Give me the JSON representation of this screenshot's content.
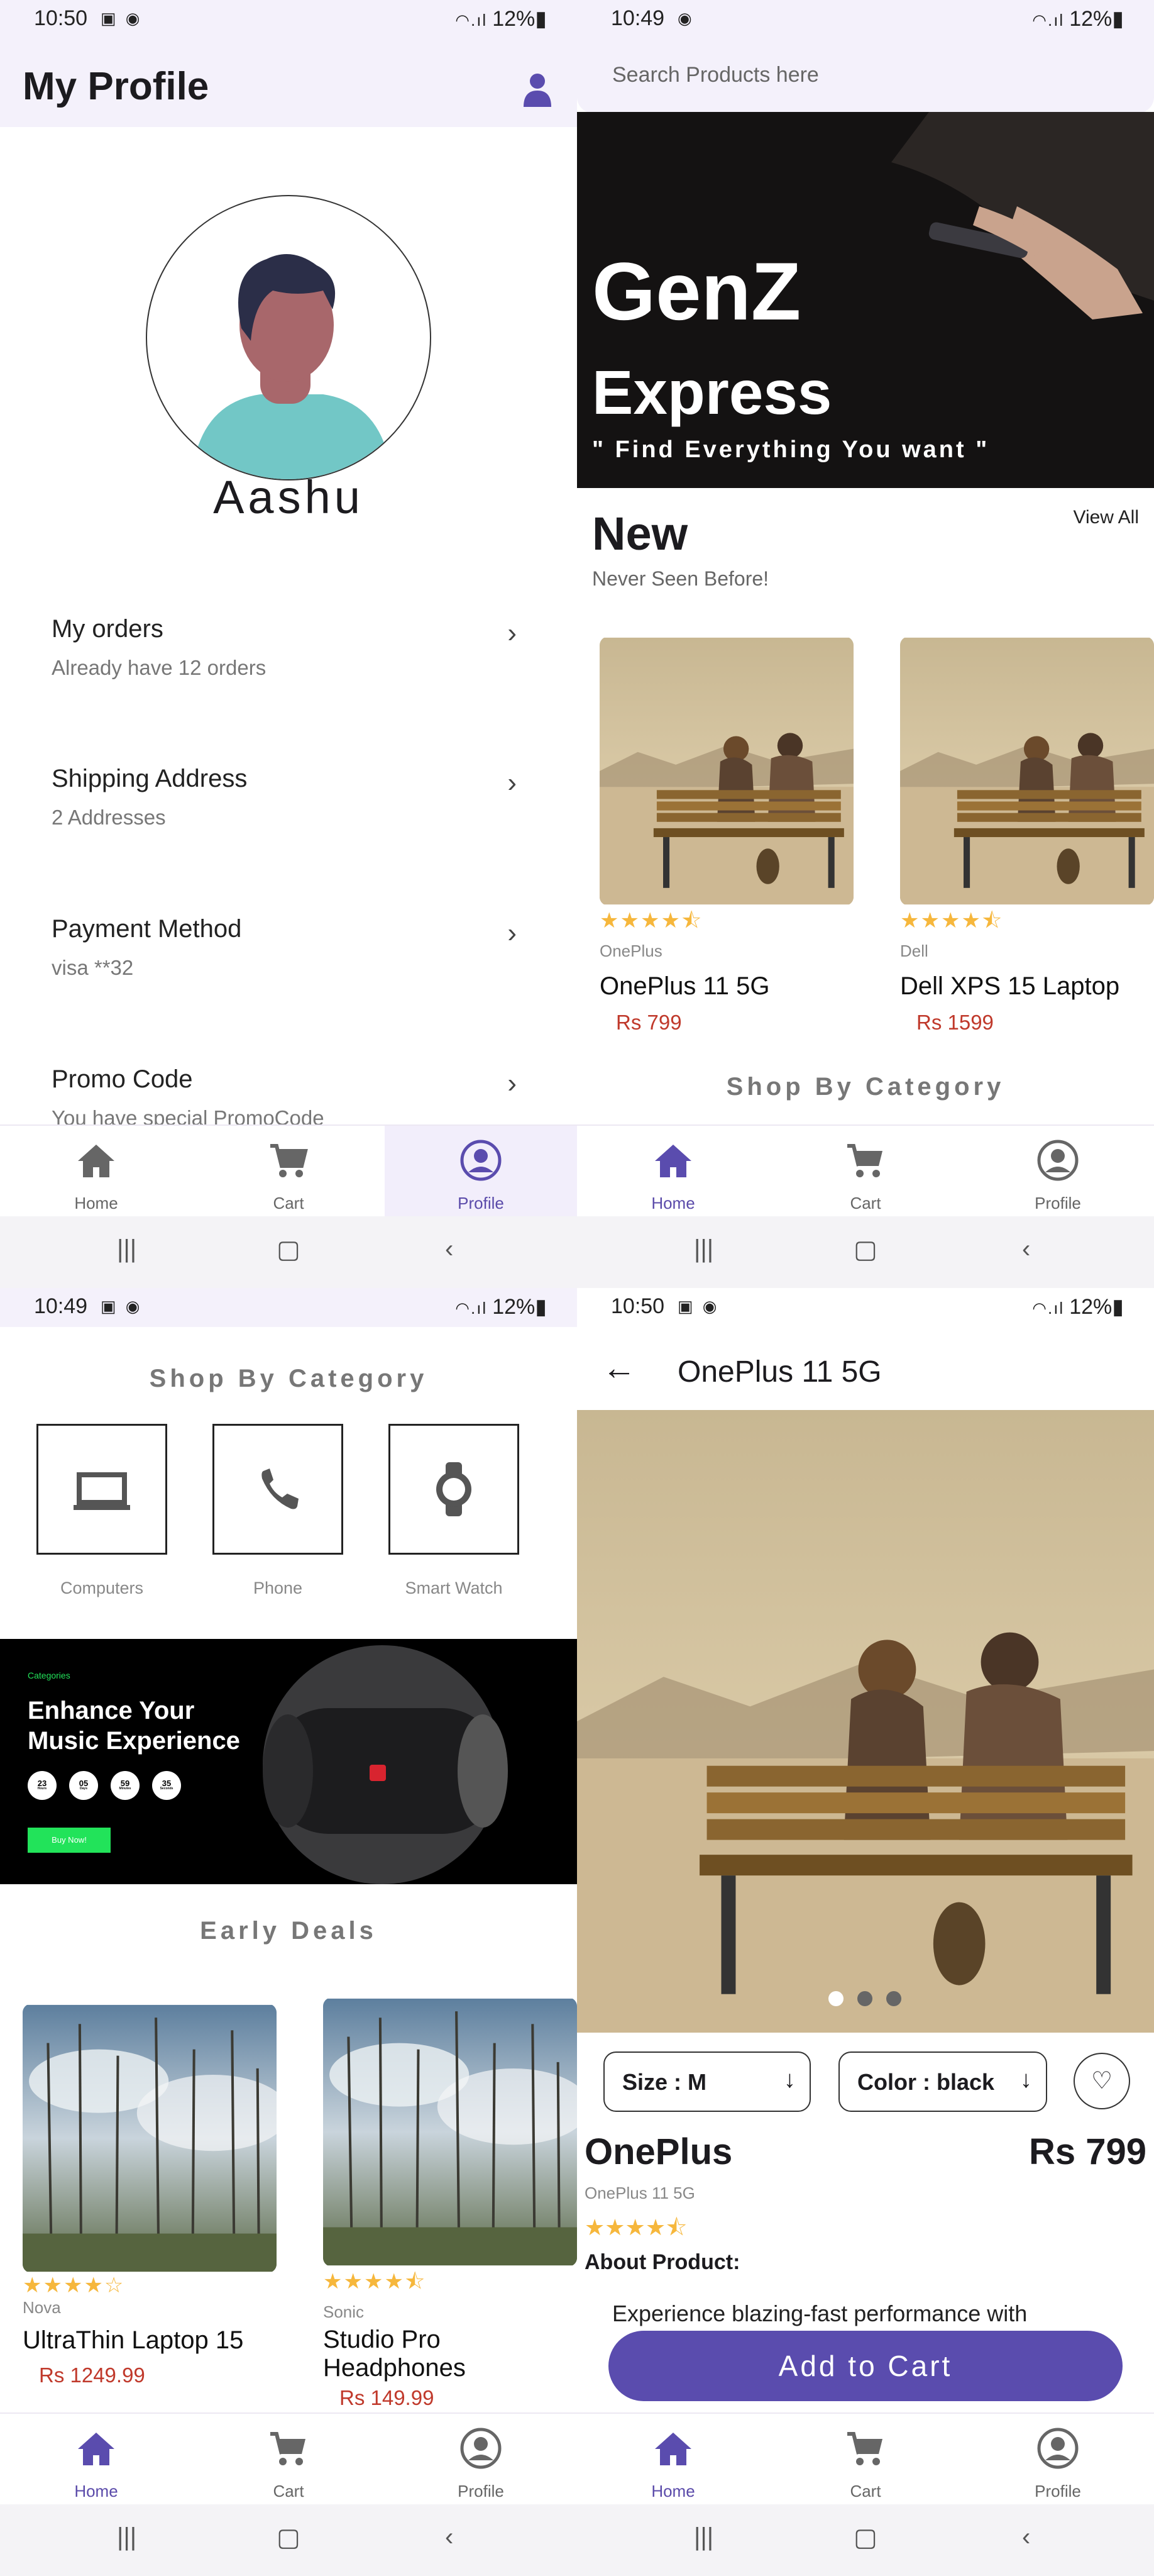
{
  "status_bars": [
    {
      "time": "10:50",
      "battery": "12%"
    },
    {
      "time": "10:49",
      "battery": "12%"
    },
    {
      "time": "10:49",
      "battery": "12%"
    },
    {
      "time": "10:50",
      "battery": "12%"
    }
  ],
  "bottom_nav": {
    "home": "Home",
    "cart": "Cart",
    "profile": "Profile"
  },
  "profile": {
    "title": "My Profile",
    "name": "Aashu",
    "menu": [
      {
        "title": "My orders",
        "subtitle": "Already have 12 orders"
      },
      {
        "title": "Shipping Address",
        "subtitle": "2 Addresses"
      },
      {
        "title": "Payment Method",
        "subtitle": "visa **32"
      },
      {
        "title": "Promo Code",
        "subtitle": "You have special PromoCode"
      }
    ]
  },
  "home": {
    "search_placeholder": "Search Products here",
    "hero": {
      "title_line1": "GenZ",
      "title_line2": "Express",
      "tagline": "\" Find Everything You want \""
    },
    "new_section": {
      "title": "New",
      "subtitle": "Never Seen Before!",
      "view_all": "View All"
    },
    "products": [
      {
        "brand": "OnePlus",
        "name": "OnePlus 11 5G",
        "price": "Rs 799",
        "rating": 4.5
      },
      {
        "brand": "Dell",
        "name": "Dell XPS 15 Laptop",
        "price": "Rs 1599",
        "rating": 4.5
      }
    ],
    "shop_by_category": "Shop By Category"
  },
  "category": {
    "title": "Shop By Category",
    "items": [
      {
        "label": "Computers",
        "icon": "laptop-icon"
      },
      {
        "label": "Phone",
        "icon": "phone-icon"
      },
      {
        "label": "Smart Watch",
        "icon": "watch-icon"
      }
    ],
    "promo": {
      "category": "Categories",
      "headline_line1": "Enhance Your",
      "headline_line2": "Music Experience",
      "timer": [
        "23",
        "05",
        "59",
        "35"
      ],
      "timer_units": [
        "Hours",
        "Days",
        "Minutes",
        "Seconds"
      ],
      "button": "Buy Now!"
    },
    "early_deals": "Early Deals",
    "deals": [
      {
        "brand": "Nova",
        "name": "UltraThin Laptop 15",
        "price": "Rs 1249.99",
        "rating": 4
      },
      {
        "brand": "Sonic",
        "name_line1": "Studio Pro",
        "name_line2": "Headphones",
        "price": "Rs 149.99",
        "rating": 4.5
      }
    ]
  },
  "details": {
    "title": "OnePlus 11 5G",
    "size": "Size : M",
    "color": "Color : black",
    "brand": "OnePlus",
    "price": "Rs 799",
    "model": "OnePlus 11 5G",
    "rating": 4.5,
    "about_label": "About Product:",
    "description": "Experience blazing-fast performance with",
    "add_to_cart": "Add to Cart",
    "carousel_index": 1,
    "carousel_count": 3
  },
  "colors": {
    "accent": "#5a4cae",
    "price": "#c0392b",
    "star": "#f6b73c",
    "header_bg": "#f4f1fb"
  }
}
